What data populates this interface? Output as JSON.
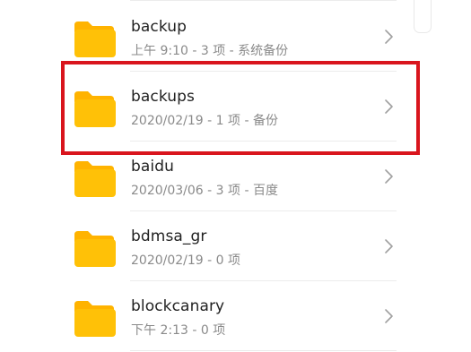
{
  "folders": [
    {
      "name": "backup",
      "meta": "上午 9:10  - 3 项 - 系统备份"
    },
    {
      "name": "backups",
      "meta": "2020/02/19 - 1 项 - 备份"
    },
    {
      "name": "baidu",
      "meta": "2020/03/06 - 3 项 - 百度"
    },
    {
      "name": "bdmsa_gr",
      "meta": "2020/02/19 - 0 项"
    },
    {
      "name": "blockcanary",
      "meta": "下午 2:13  - 0 项"
    }
  ],
  "highlighted_item": "backups",
  "colors": {
    "folder": "#FFC107",
    "folder_tab": "#FFB300",
    "highlight_border": "#D9151D",
    "chevron": "#A0A0A0"
  },
  "icons": {
    "folder": "folder-icon",
    "chevron": "chevron-right-icon"
  }
}
